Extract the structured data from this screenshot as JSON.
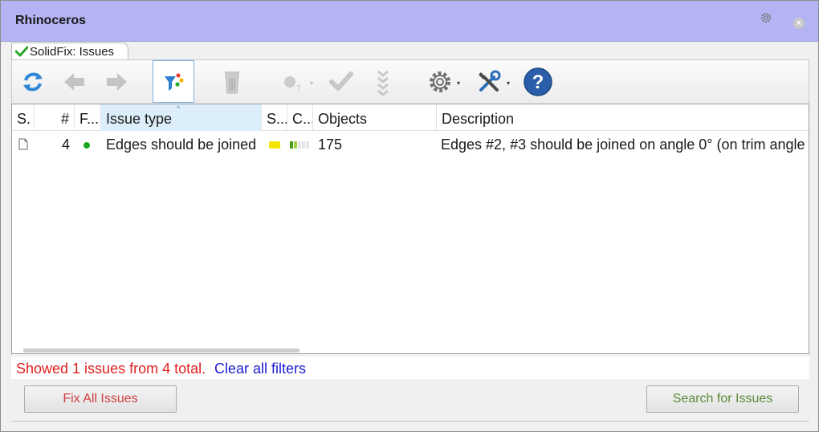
{
  "window": {
    "title": "Rhinoceros",
    "close_glyph": "×"
  },
  "tab": {
    "label": "SolidFix: Issues",
    "icon": "check-icon"
  },
  "toolbar": {
    "buttons": [
      {
        "name": "refresh-icon",
        "enabled": true
      },
      {
        "name": "back-arrow-icon",
        "enabled": false
      },
      {
        "name": "forward-arrow-icon",
        "enabled": false
      },
      {
        "name": "filter-icon",
        "enabled": true,
        "active": true
      },
      {
        "name": "trash-icon",
        "enabled": false
      },
      {
        "name": "status-dot-icon",
        "enabled": false,
        "dropdown": true
      },
      {
        "name": "checkmark-icon",
        "enabled": false
      },
      {
        "name": "double-chevron-down-icon",
        "enabled": false
      },
      {
        "name": "gear-icon",
        "enabled": true,
        "dropdown": true
      },
      {
        "name": "tools-icon",
        "enabled": true,
        "dropdown": true
      },
      {
        "name": "help-icon",
        "enabled": true
      }
    ],
    "help_glyph": "?",
    "dropdown_glyph": "▾",
    "secondary_glyph": "?"
  },
  "grid": {
    "columns": [
      "S.",
      "#",
      "F...",
      "Issue type",
      "S...",
      "C...",
      "Objects",
      "Description"
    ],
    "sort_caret": "^",
    "rows": [
      {
        "status_icon": "document-icon",
        "number": "4",
        "flag_color": "#1aa81a",
        "issue_type": "Edges should be joined",
        "severity_color": "#f2e600",
        "objects": "175",
        "description": "Edges #2, #3 should be joined on angle 0° (on trim angle"
      }
    ]
  },
  "status": {
    "message": "Showed 1 issues from 4 total.",
    "clear_link": "Clear all filters"
  },
  "buttons": {
    "fix_all": "Fix All Issues",
    "search": "Search for Issues"
  },
  "colors": {
    "titlebar": "#b4b4f5",
    "status_red": "#e02020",
    "link_blue": "#1a1ad0",
    "fix_label": "#d04040",
    "search_label": "#5a8a3a"
  }
}
